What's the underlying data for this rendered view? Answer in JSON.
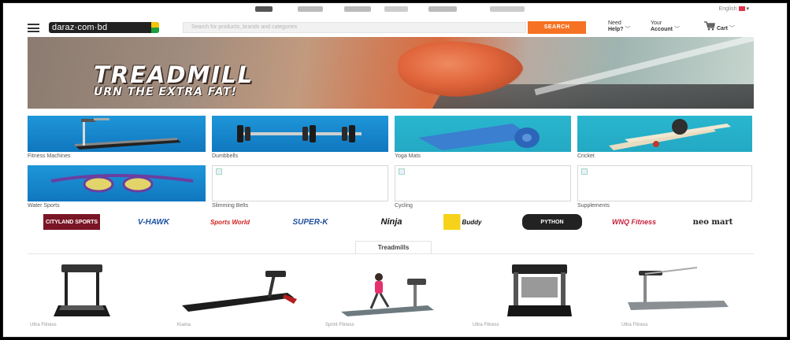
{
  "header": {
    "logo_text": "daraz·com·bd",
    "search_placeholder": "Search for products, brands and categories",
    "search_button": "SEARCH",
    "help_line1": "Need",
    "help_line2": "Help?",
    "account_line1": "Your",
    "account_line2": "Account",
    "cart_label": "Cart"
  },
  "top_strip": {
    "language": "English"
  },
  "banner": {
    "headline": "TREADMILL",
    "tagline": "URN THE EXTRA FAT!"
  },
  "categories": [
    {
      "label": "Fitness Machines"
    },
    {
      "label": "Dumbbells"
    },
    {
      "label": "Yoga Mats"
    },
    {
      "label": "Cricket"
    },
    {
      "label": "Water Sports"
    },
    {
      "label": "Slimming Belts"
    },
    {
      "label": "Cycling"
    },
    {
      "label": "Supplements"
    }
  ],
  "brands": [
    {
      "name": "CITYLAND SPORTS",
      "color": "#8b1a2b"
    },
    {
      "name": "V-HAWK",
      "color": "#1a4fa0"
    },
    {
      "name": "Sports World",
      "color": "#d0201f"
    },
    {
      "name": "SUPER-K",
      "color": "#1f4f9e"
    },
    {
      "name": "Ninja",
      "color": "#111111"
    },
    {
      "name": "Buddy",
      "color": "#111111"
    },
    {
      "name": "PYTHON",
      "color": "#222222"
    },
    {
      "name": "WNQ Fitness",
      "color": "#c8213c"
    },
    {
      "name": "neo mart",
      "color": "#222222"
    }
  ],
  "section": {
    "title": "Treadmills"
  },
  "products": [
    {
      "name": "Ultra Fitness"
    },
    {
      "name": "Kiama"
    },
    {
      "name": "Sprint Fitness"
    },
    {
      "name": "Ultra Fitness"
    },
    {
      "name": "Ultra Fitness"
    }
  ],
  "colors": {
    "accent": "#f57224",
    "tile_blue": "#1a8dd2"
  }
}
